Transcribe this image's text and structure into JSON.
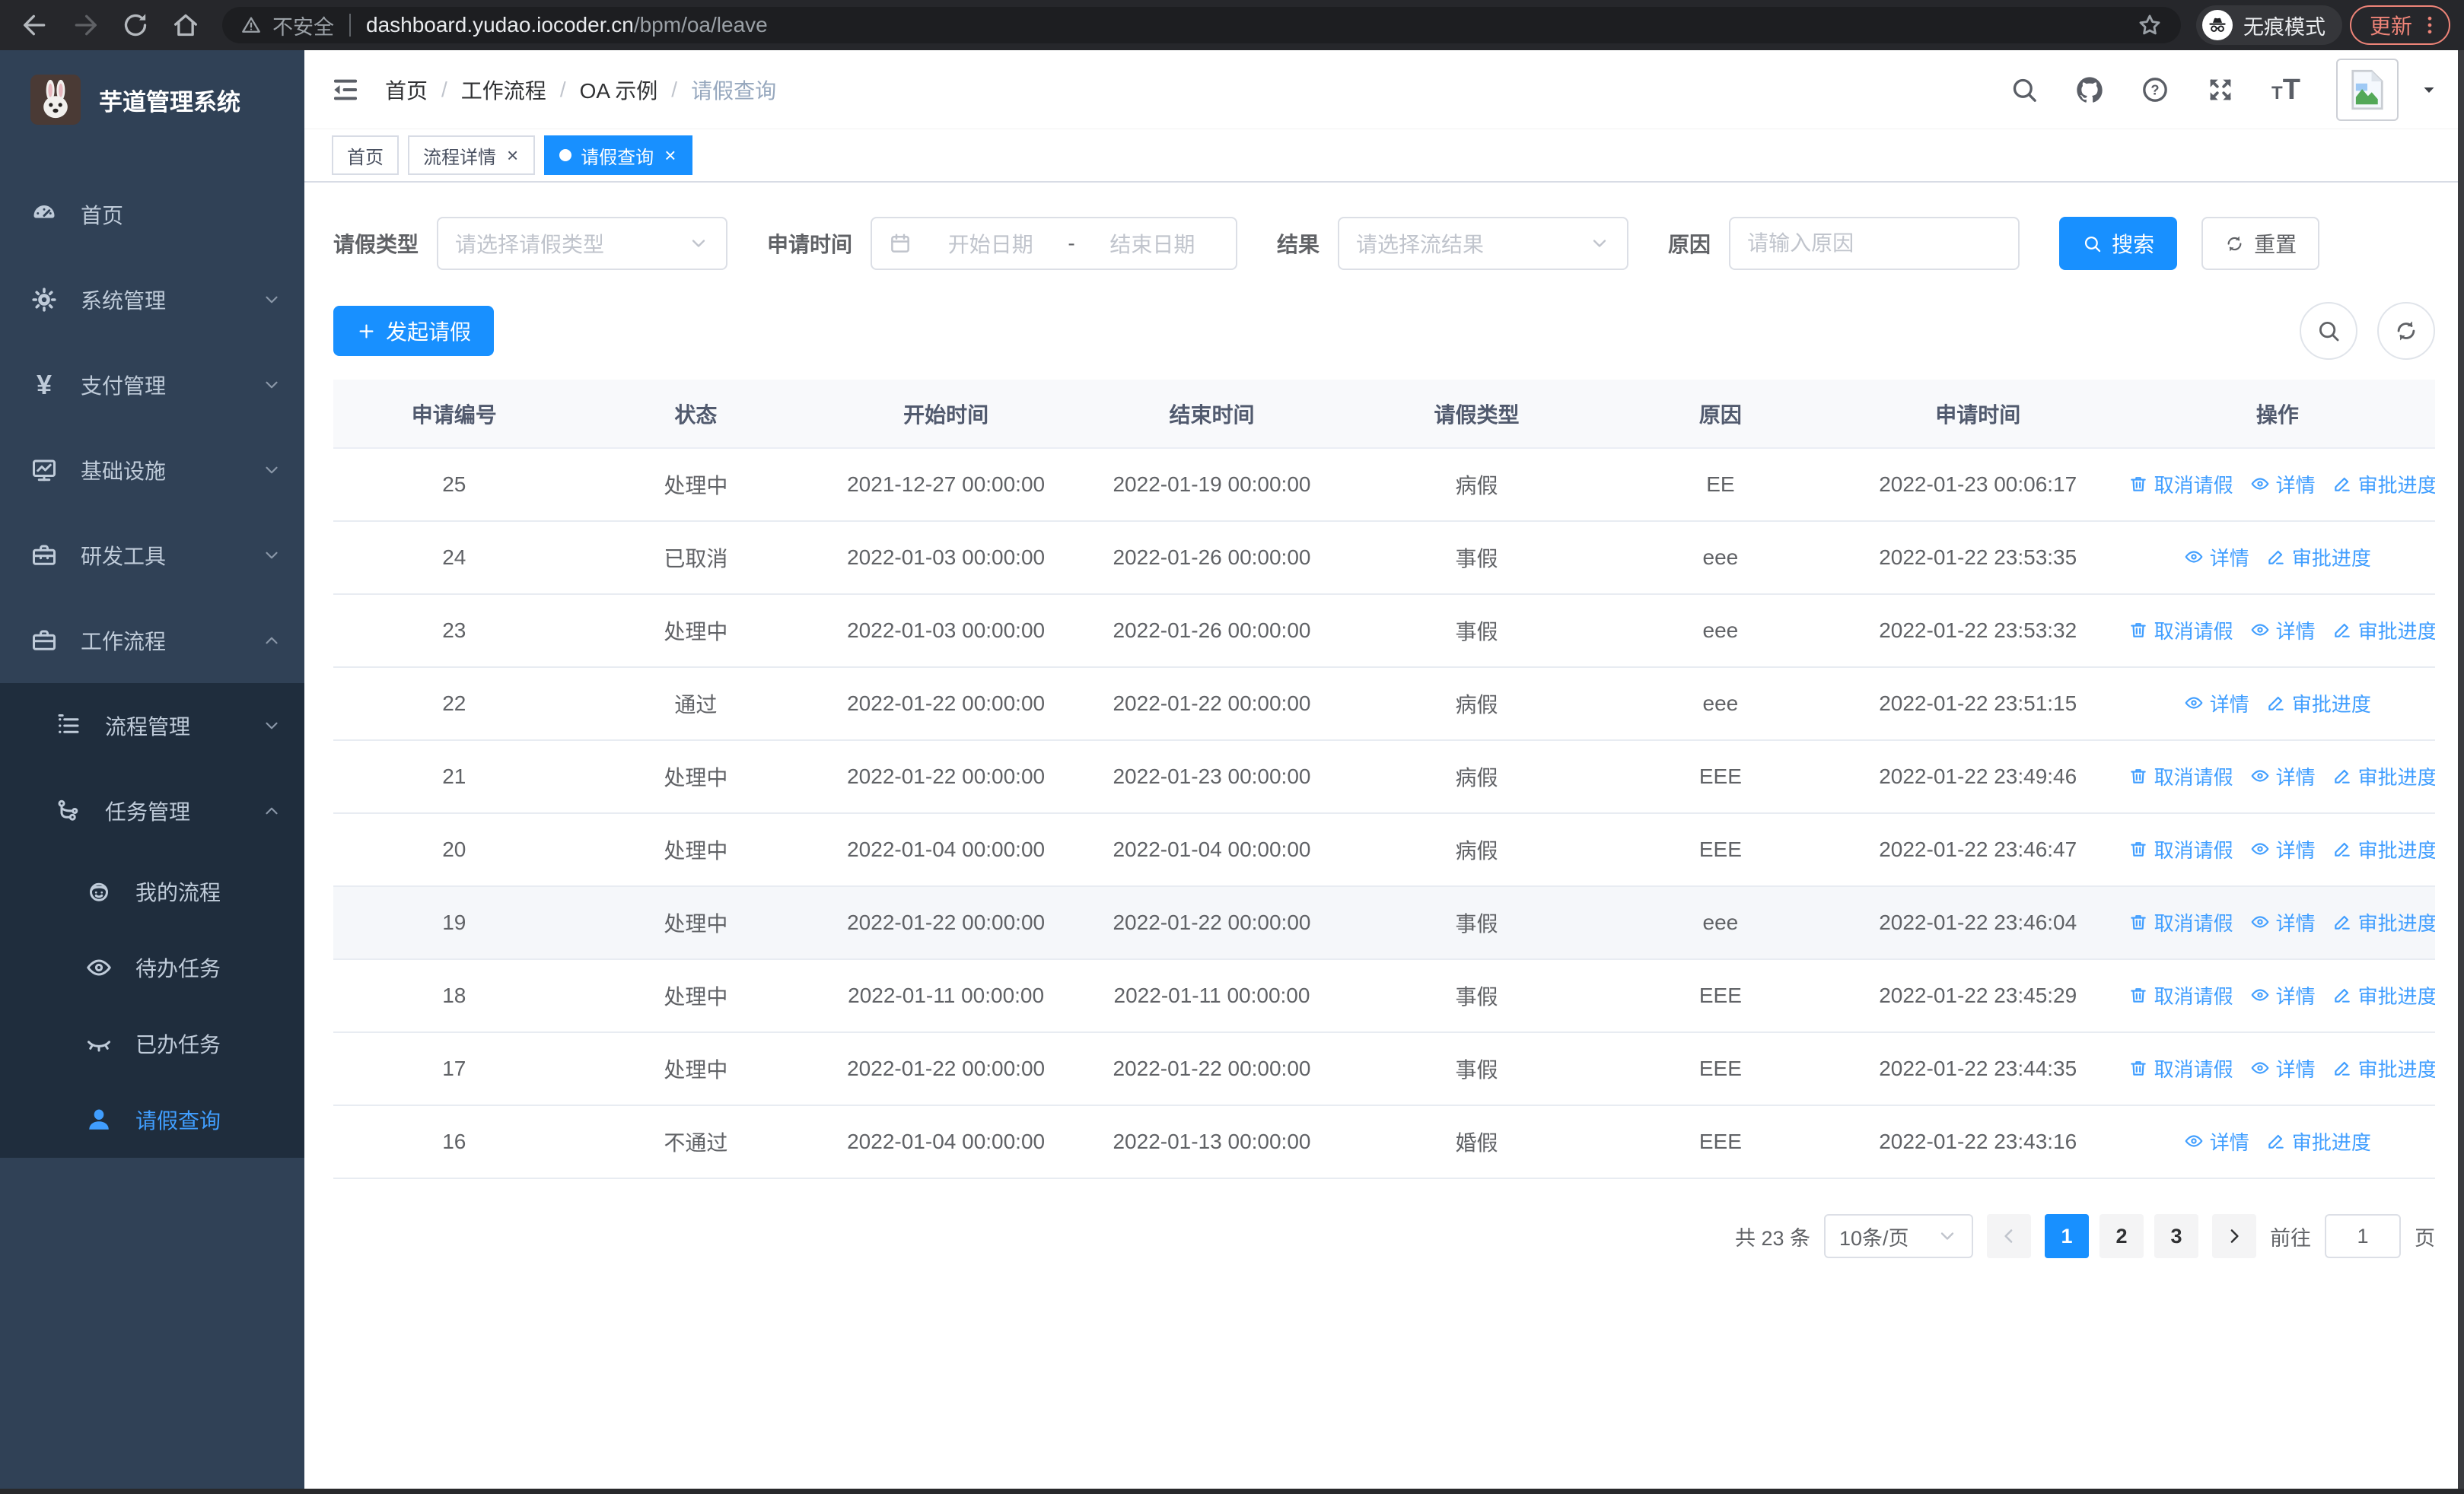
{
  "browser": {
    "security_label": "不安全",
    "url_host": "dashboard.yudao.iocoder.cn",
    "url_path": "/bpm/oa/leave",
    "incognito_label": "无痕模式",
    "update_label": "更新"
  },
  "sidebar": {
    "title": "芋道管理系统",
    "items": [
      {
        "label": "首页",
        "icon": "dashboard-icon"
      },
      {
        "label": "系统管理",
        "icon": "gear-icon",
        "arrow": "down"
      },
      {
        "label": "支付管理",
        "icon": "yen-icon",
        "arrow": "down"
      },
      {
        "label": "基础设施",
        "icon": "monitor-icon",
        "arrow": "down"
      },
      {
        "label": "研发工具",
        "icon": "toolbox-icon",
        "arrow": "down"
      },
      {
        "label": "工作流程",
        "icon": "briefcase-icon",
        "arrow": "up",
        "children": [
          {
            "label": "流程管理",
            "icon": "list-icon",
            "arrow": "down"
          },
          {
            "label": "任务管理",
            "icon": "flow-icon",
            "arrow": "up",
            "children": [
              {
                "label": "我的流程",
                "icon": "robot-icon"
              },
              {
                "label": "待办任务",
                "icon": "eye-icon"
              },
              {
                "label": "已办任务",
                "icon": "eye-closed-icon"
              },
              {
                "label": "请假查询",
                "icon": "user-icon",
                "active": true
              }
            ]
          }
        ]
      }
    ]
  },
  "header": {
    "breadcrumb": [
      "首页",
      "工作流程",
      "OA 示例",
      "请假查询"
    ]
  },
  "tabs": [
    {
      "label": "首页"
    },
    {
      "label": "流程详情",
      "closable": true
    },
    {
      "label": "请假查询",
      "closable": true,
      "active": true
    }
  ],
  "filters": {
    "leave_type_label": "请假类型",
    "leave_type_placeholder": "请选择请假类型",
    "apply_time_label": "申请时间",
    "start_date_placeholder": "开始日期",
    "range_separator": "-",
    "end_date_placeholder": "结束日期",
    "result_label": "结果",
    "result_placeholder": "请选择流结果",
    "reason_label": "原因",
    "reason_placeholder": "请输入原因",
    "search_label": "搜索",
    "reset_label": "重置"
  },
  "toolbar": {
    "create_label": "发起请假"
  },
  "table": {
    "columns": [
      "申请编号",
      "状态",
      "开始时间",
      "结束时间",
      "请假类型",
      "原因",
      "申请时间",
      "操作"
    ],
    "action_labels": {
      "cancel": "取消请假",
      "detail": "详情",
      "progress": "审批进度"
    },
    "rows": [
      {
        "id": "25",
        "status": "处理中",
        "start_time": "2021-12-27 00:00:00",
        "end_time": "2022-01-19 00:00:00",
        "leave_type": "病假",
        "reason": "EE",
        "apply_time": "2022-01-23 00:06:17",
        "actions": [
          "cancel",
          "detail",
          "progress"
        ]
      },
      {
        "id": "24",
        "status": "已取消",
        "start_time": "2022-01-03 00:00:00",
        "end_time": "2022-01-26 00:00:00",
        "leave_type": "事假",
        "reason": "eee",
        "apply_time": "2022-01-22 23:53:35",
        "actions": [
          "detail",
          "progress"
        ]
      },
      {
        "id": "23",
        "status": "处理中",
        "start_time": "2022-01-03 00:00:00",
        "end_time": "2022-01-26 00:00:00",
        "leave_type": "事假",
        "reason": "eee",
        "apply_time": "2022-01-22 23:53:32",
        "actions": [
          "cancel",
          "detail",
          "progress"
        ]
      },
      {
        "id": "22",
        "status": "通过",
        "start_time": "2022-01-22 00:00:00",
        "end_time": "2022-01-22 00:00:00",
        "leave_type": "病假",
        "reason": "eee",
        "apply_time": "2022-01-22 23:51:15",
        "actions": [
          "detail",
          "progress"
        ]
      },
      {
        "id": "21",
        "status": "处理中",
        "start_time": "2022-01-22 00:00:00",
        "end_time": "2022-01-23 00:00:00",
        "leave_type": "病假",
        "reason": "EEE",
        "apply_time": "2022-01-22 23:49:46",
        "actions": [
          "cancel",
          "detail",
          "progress"
        ]
      },
      {
        "id": "20",
        "status": "处理中",
        "start_time": "2022-01-04 00:00:00",
        "end_time": "2022-01-04 00:00:00",
        "leave_type": "病假",
        "reason": "EEE",
        "apply_time": "2022-01-22 23:46:47",
        "actions": [
          "cancel",
          "detail",
          "progress"
        ]
      },
      {
        "id": "19",
        "status": "处理中",
        "start_time": "2022-01-22 00:00:00",
        "end_time": "2022-01-22 00:00:00",
        "leave_type": "事假",
        "reason": "eee",
        "apply_time": "2022-01-22 23:46:04",
        "actions": [
          "cancel",
          "detail",
          "progress"
        ],
        "highlighted": true
      },
      {
        "id": "18",
        "status": "处理中",
        "start_time": "2022-01-11 00:00:00",
        "end_time": "2022-01-11 00:00:00",
        "leave_type": "事假",
        "reason": "EEE",
        "apply_time": "2022-01-22 23:45:29",
        "actions": [
          "cancel",
          "detail",
          "progress"
        ]
      },
      {
        "id": "17",
        "status": "处理中",
        "start_time": "2022-01-22 00:00:00",
        "end_time": "2022-01-22 00:00:00",
        "leave_type": "事假",
        "reason": "EEE",
        "apply_time": "2022-01-22 23:44:35",
        "actions": [
          "cancel",
          "detail",
          "progress"
        ]
      },
      {
        "id": "16",
        "status": "不通过",
        "start_time": "2022-01-04 00:00:00",
        "end_time": "2022-01-13 00:00:00",
        "leave_type": "婚假",
        "reason": "EEE",
        "apply_time": "2022-01-22 23:43:16",
        "actions": [
          "detail",
          "progress"
        ]
      }
    ]
  },
  "pagination": {
    "total_label": "共 23 条",
    "page_size_value": "10条/页",
    "pages": [
      "1",
      "2",
      "3"
    ],
    "active_page": "1",
    "goto_label": "前往",
    "goto_value": "1",
    "goto_suffix": "页"
  },
  "colors": {
    "primary": "#1890ff",
    "link": "#409eff",
    "sidebar_bg": "#304156",
    "submenu_bg": "#1f2d3d",
    "sidebar_text": "#bfcbd9",
    "active_menu_text": "#409eff",
    "update_button": "#ee8478"
  }
}
